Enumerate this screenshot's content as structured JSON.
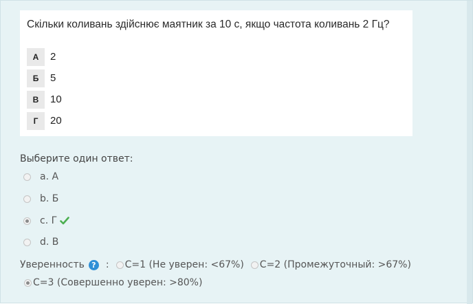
{
  "question": {
    "text": "Скільки коливань здійснює маятник за 10 с, якщо частота коливань 2 Гц?",
    "options": [
      {
        "letter": "А",
        "value": "2"
      },
      {
        "letter": "Б",
        "value": "5"
      },
      {
        "letter": "В",
        "value": "10"
      },
      {
        "letter": "Г",
        "value": "20"
      }
    ]
  },
  "answer": {
    "prompt": "Выберите один ответ:",
    "choices": [
      {
        "label": "a. А",
        "checked": false
      },
      {
        "label": "b. Б",
        "checked": false
      },
      {
        "label": "c. Г",
        "checked": true,
        "correct": true
      },
      {
        "label": "d. В",
        "checked": false
      }
    ]
  },
  "confidence": {
    "label": "Уверенность",
    "help_icon": "question-circle-icon",
    "help_glyph": "?",
    "colon": ":",
    "options": [
      {
        "label": "C=1 (Не уверен: <67%)",
        "checked": false
      },
      {
        "label": "C=2 (Промежуточный: >67%)",
        "checked": false
      },
      {
        "label": "C=3 (Совершенно уверен: >80%)",
        "checked": true
      }
    ]
  },
  "colors": {
    "page_background": "#e7f3f5",
    "correct_check": "#4caf50",
    "help_icon": "#2f8fd6"
  }
}
